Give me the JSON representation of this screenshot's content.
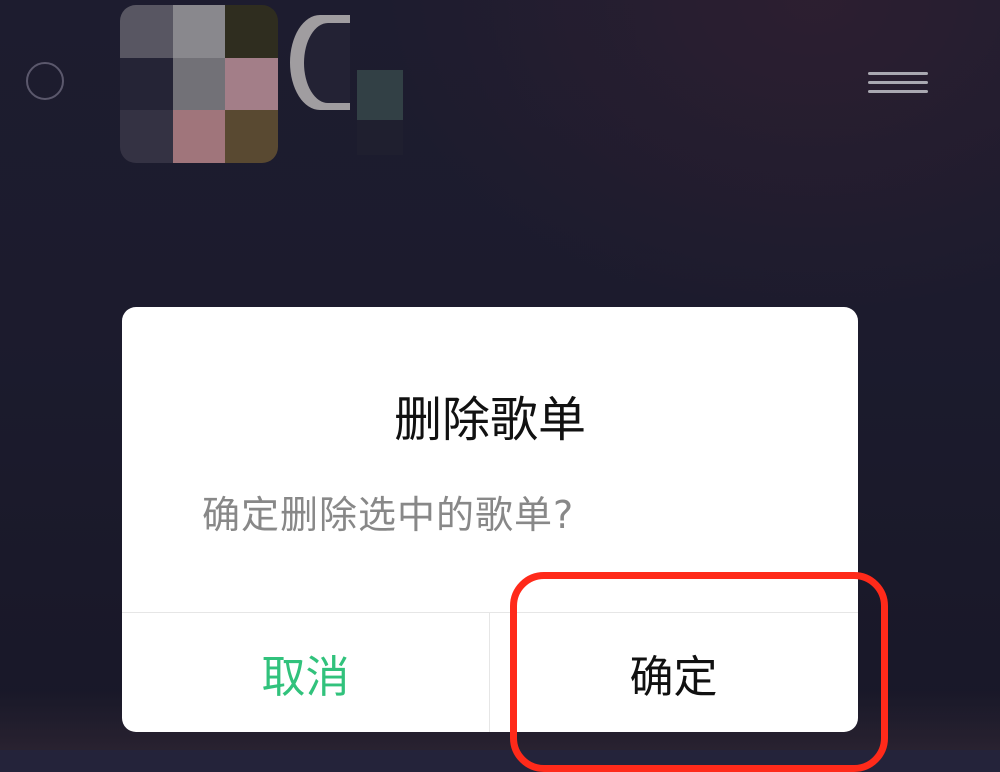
{
  "dialog": {
    "title": "删除歌单",
    "message": "确定删除选中的歌单?",
    "cancel_label": "取消",
    "confirm_label": "确定"
  },
  "colors": {
    "accent_green": "#31c27c",
    "highlight_red": "#ff2a1a",
    "background": "#24233a"
  },
  "icons": {
    "left": "circle-icon",
    "right": "menu-icon"
  }
}
